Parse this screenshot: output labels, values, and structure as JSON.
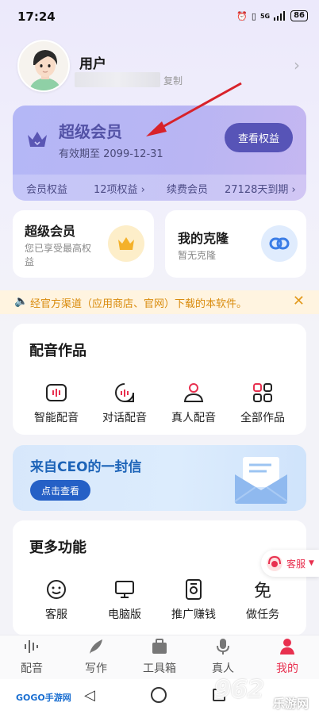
{
  "status": {
    "time": "17:24",
    "battery": "86",
    "network": "5G"
  },
  "profile": {
    "name": "用户",
    "copy_label": "复制"
  },
  "member": {
    "title": "超级会员",
    "expire": "有效期至 2099-12-31",
    "view_button": "查看权益",
    "benefits_label": "会员权益",
    "benefits_count": "12项权益 ›",
    "renew_label": "续费会员",
    "renew_days": "27128天到期 ›"
  },
  "cards": {
    "svip": {
      "title": "超级会员",
      "subtitle_line1": "您已享受最高权",
      "subtitle_line2": "益"
    },
    "clone": {
      "title": "我的克隆",
      "subtitle": "暂无克隆"
    }
  },
  "notice": {
    "text": "经官方渠道（应用商店、官网）下载的本软件。"
  },
  "works": {
    "title": "配音作品",
    "items": [
      {
        "label": "智能配音",
        "icon": "smart-dub-icon"
      },
      {
        "label": "对话配音",
        "icon": "dialog-dub-icon"
      },
      {
        "label": "真人配音",
        "icon": "human-dub-icon"
      },
      {
        "label": "全部作品",
        "icon": "all-works-icon"
      }
    ]
  },
  "ceo": {
    "title": "来自CEO的一封信",
    "button": "点击查看"
  },
  "more": {
    "title": "更多功能",
    "items": [
      {
        "label": "客服",
        "icon": "smile-icon"
      },
      {
        "label": "电脑版",
        "icon": "monitor-icon"
      },
      {
        "label": "推广赚钱",
        "icon": "promote-icon"
      },
      {
        "label": "做任务",
        "icon": "task-icon"
      }
    ]
  },
  "support_float": {
    "label": "客服"
  },
  "tabs": [
    {
      "label": "配音",
      "icon": "waveform-icon"
    },
    {
      "label": "写作",
      "icon": "feather-icon"
    },
    {
      "label": "工具箱",
      "icon": "toolbox-icon"
    },
    {
      "label": "真人",
      "icon": "microphone-icon"
    },
    {
      "label": "我的",
      "icon": "person-icon",
      "active": true
    }
  ],
  "watermarks": {
    "left": "GOGO手游网",
    "right_top": "962",
    "right_bottom": "乐游网"
  },
  "colors": {
    "accent": "#e8304f",
    "member_dark": "#5754b7",
    "ceo_blue": "#2560c6"
  }
}
